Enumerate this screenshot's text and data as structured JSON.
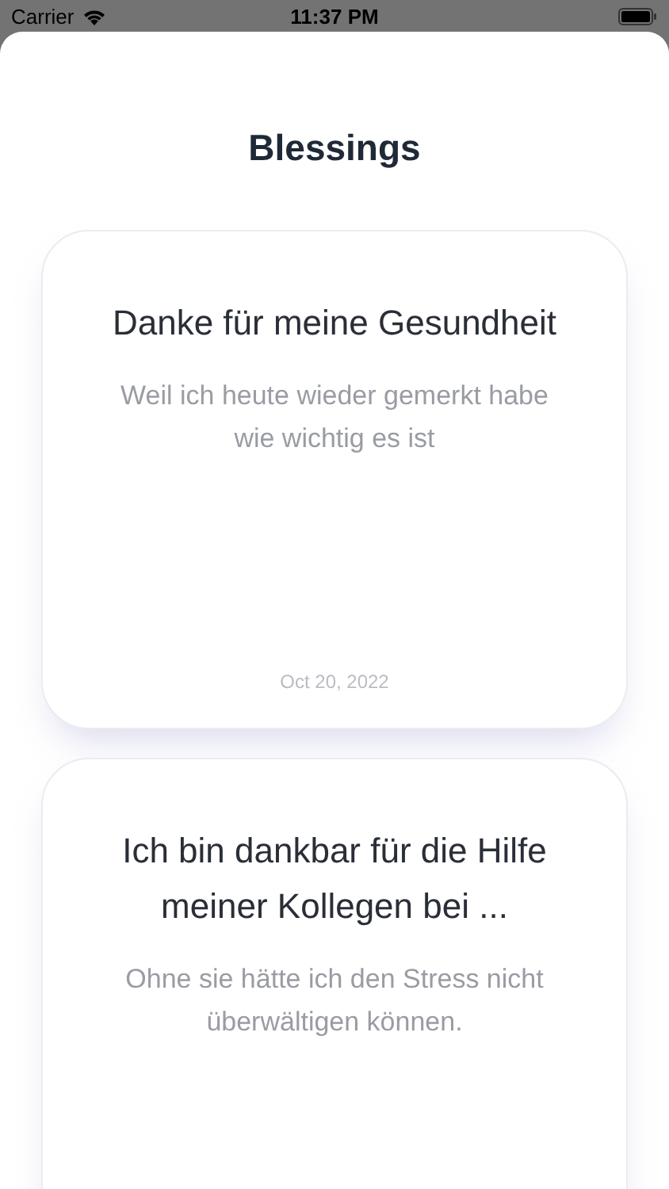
{
  "status_bar": {
    "carrier": "Carrier",
    "time": "11:37 PM"
  },
  "title": "Blessings",
  "cards": [
    {
      "title": "Danke für meine Gesundheit",
      "text": "Weil ich heute wieder gemerkt habe wie wichtig es ist",
      "date": "Oct 20, 2022"
    },
    {
      "title": "Ich bin dankbar für die Hilfe meiner Kollegen bei ...",
      "text": "Ohne sie hätte ich den Stress nicht überwältigen können."
    }
  ]
}
